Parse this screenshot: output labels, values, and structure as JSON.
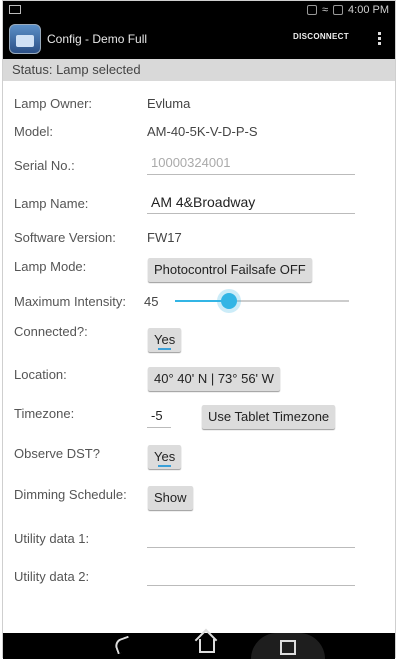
{
  "statusbar": {
    "time": "4:00 PM"
  },
  "actionbar": {
    "title": "Config - Demo Full",
    "disconnect_label": "DISCONNECT"
  },
  "status": {
    "text": "Status: Lamp selected"
  },
  "form": {
    "owner": {
      "label": "Lamp Owner:",
      "value": "Evluma"
    },
    "model": {
      "label": "Model:",
      "value": "AM-40-5K-V-D-P-S"
    },
    "serial": {
      "label": "Serial No.:",
      "value": "10000324001"
    },
    "name": {
      "label": "Lamp Name:",
      "value": "AM 4&Broadway"
    },
    "software": {
      "label": "Software Version:",
      "value": "FW17"
    },
    "mode": {
      "label": "Lamp Mode:",
      "button": "Photocontrol Failsafe OFF"
    },
    "intensity": {
      "label": "Maximum Intensity:",
      "value": "45",
      "slider_fraction": 0.31
    },
    "connected": {
      "label": "Connected?:",
      "toggle": "Yes"
    },
    "location": {
      "label": "Location:",
      "button": "40° 40' N | 73° 56' W"
    },
    "timezone": {
      "label": "Timezone:",
      "value": "-5",
      "button": "Use Tablet Timezone"
    },
    "dst": {
      "label": "Observe DST?",
      "toggle": "Yes"
    },
    "schedule": {
      "label": "Dimming Schedule:",
      "button": "Show"
    },
    "utility1": {
      "label": "Utility data 1:",
      "value": ""
    },
    "utility2": {
      "label": "Utility data 2:",
      "value": ""
    }
  },
  "colors": {
    "accent": "#33b5e5",
    "statusbar": "#000000",
    "status_row": "#d9d9d9"
  }
}
